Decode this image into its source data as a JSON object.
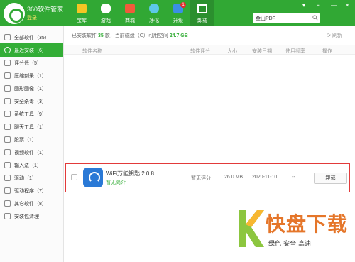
{
  "app": {
    "name": "360软件管家",
    "login": "登录"
  },
  "tabs": [
    {
      "label": "宝库",
      "icon": "star-icon",
      "color": "#f5c524"
    },
    {
      "label": "游戏",
      "icon": "gamepad-icon",
      "color": "#ffffff"
    },
    {
      "label": "商城",
      "icon": "shop-bag-icon",
      "color": "#f05a3b"
    },
    {
      "label": "净化",
      "icon": "purify-icon",
      "color": "#5dc8e8"
    },
    {
      "label": "升级",
      "icon": "upgrade-arrow-icon",
      "color": "#3b8fe5",
      "badge": "1"
    },
    {
      "label": "卸载",
      "icon": "trash-icon",
      "color": "#ffffff"
    }
  ],
  "search": {
    "value": "金山PDF"
  },
  "sidebar": {
    "items": [
      {
        "label": "全部软件（35）",
        "icon": "grid-icon"
      },
      {
        "label": "最近安装（6）",
        "icon": "clock-icon"
      },
      {
        "label": "评分低（5）",
        "icon": "low-rating-icon"
      },
      {
        "label": "压缩刻录（1）",
        "icon": "compress-icon"
      },
      {
        "label": "图形图像（1）",
        "icon": "image-icon"
      },
      {
        "label": "安全杀毒（3）",
        "icon": "shield-icon"
      },
      {
        "label": "系统工具（9）",
        "icon": "system-tool-icon"
      },
      {
        "label": "聊天工具（1）",
        "icon": "chat-icon"
      },
      {
        "label": "股票（1）",
        "icon": "stock-icon"
      },
      {
        "label": "视频软件（1）",
        "icon": "video-icon"
      },
      {
        "label": "输入法（1）",
        "icon": "input-method-icon"
      },
      {
        "label": "驱动（1）",
        "icon": "driver-icon"
      },
      {
        "label": "驱动程序（7）",
        "icon": "driver-program-icon"
      },
      {
        "label": "其它软件（8）",
        "icon": "other-software-icon"
      },
      {
        "label": "安装包清理",
        "icon": "package-clean-icon"
      }
    ],
    "active_index": 1
  },
  "main": {
    "info_prefix": "已安装软件",
    "count": "35",
    "info_mid": "款，当前磁盘（C）可用空间",
    "space": "24.7 GB",
    "refresh": "刷新",
    "columns": {
      "name": "软件名称",
      "rating": "软件评分",
      "size": "大小",
      "date": "安装日期",
      "freq": "使用频率",
      "action": "操作"
    },
    "row": {
      "name": "WiFi万能钥匙 2.0.8",
      "desc": "暂无简介",
      "rating": "暂无评分",
      "size": "26.0 MB",
      "date": "2020-11-10",
      "freq": "--",
      "button": "卸载"
    }
  },
  "watermark": {
    "title": "快盘下载",
    "subtitle": "绿色·安全·高速"
  }
}
